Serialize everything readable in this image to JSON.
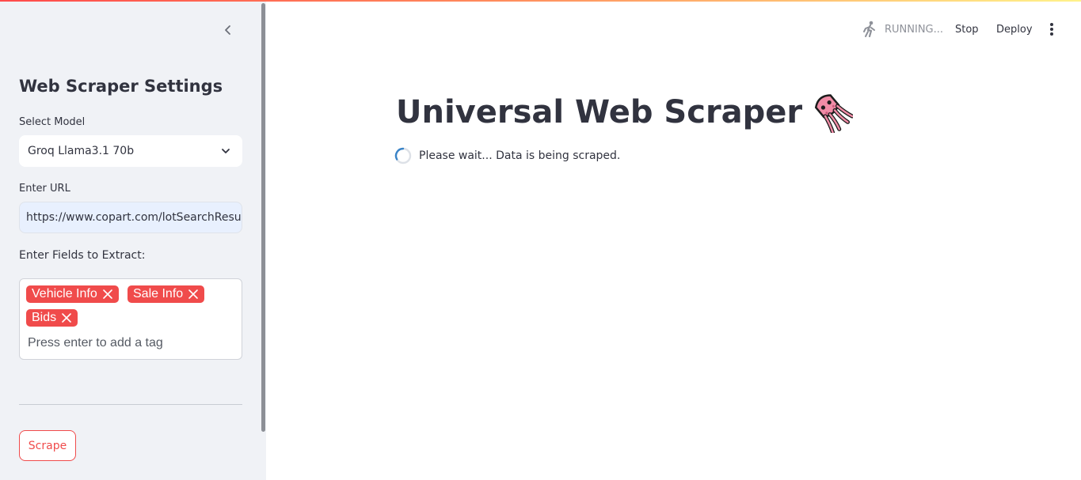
{
  "sidebar": {
    "title": "Web Scraper Settings",
    "model_label": "Select Model",
    "model_value": "Groq Llama3.1 70b",
    "url_label": "Enter URL",
    "url_value": "https://www.copart.com/lotSearchResu",
    "fields_label": "Enter Fields to Extract:",
    "tags": [
      "Vehicle Info",
      "Sale Info",
      "Bids"
    ],
    "tag_placeholder": "Press enter to add a tag",
    "scrape_label": "Scrape"
  },
  "header": {
    "running_label": "RUNNING...",
    "stop_label": "Stop",
    "deploy_label": "Deploy"
  },
  "main": {
    "title": "Universal Web Scraper",
    "status": "Please wait... Data is being scraped."
  },
  "icons": {
    "collapse": "chevron-left-icon",
    "select_caret": "chevron-down-icon",
    "tag_remove": "close-icon",
    "running": "running-man-icon",
    "menu": "more-vertical-icon",
    "title_emoji": "squid-icon",
    "spinner": "spinner-icon"
  },
  "colors": {
    "accent": "#f04b4b",
    "sidebar_bg": "#f0f2f6",
    "text": "#31333f",
    "spinner": "#3a84c8"
  }
}
